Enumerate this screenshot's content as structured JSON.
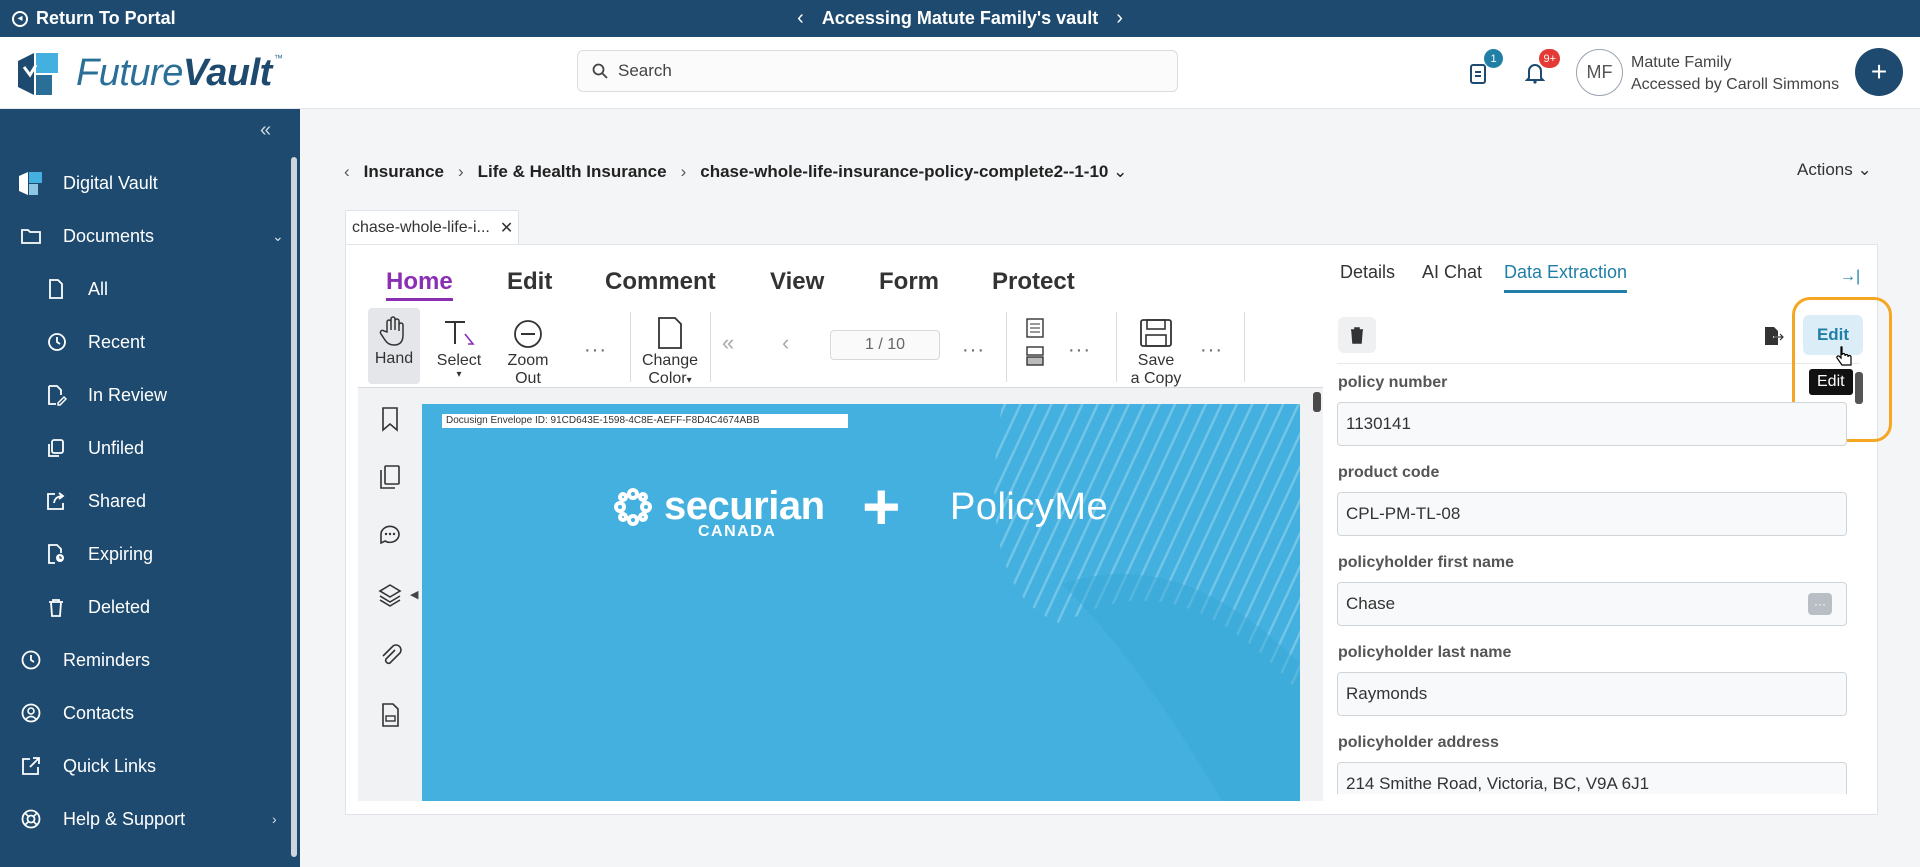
{
  "banner": {
    "return_label": "Return To Portal",
    "vault_label": "Accessing Matute Family's vault",
    "prev_glyph": "‹",
    "next_glyph": "›"
  },
  "header": {
    "logo_future": "Future",
    "logo_vault": "Vault",
    "logo_tm": "™",
    "search_placeholder": "Search",
    "doc_badge": "1",
    "notif_badge": "9+",
    "avatar_initials": "MF",
    "account_name": "Matute Family",
    "account_sub": "Accessed by Caroll Simmons",
    "fab_glyph": "+"
  },
  "sidebar": {
    "collapse_glyph": "«",
    "items": [
      {
        "label": "Digital Vault",
        "icon": "futurevault-icon"
      },
      {
        "label": "Documents",
        "icon": "folder-icon",
        "arrow": "⌄"
      },
      {
        "label": "All",
        "icon": "file-icon"
      },
      {
        "label": "Recent",
        "icon": "history-icon"
      },
      {
        "label": "In Review",
        "icon": "file-edit-icon"
      },
      {
        "label": "Unfiled",
        "icon": "copy-icon"
      },
      {
        "label": "Shared",
        "icon": "share-icon"
      },
      {
        "label": "Expiring",
        "icon": "file-clock-icon"
      },
      {
        "label": "Deleted",
        "icon": "trash-icon"
      },
      {
        "label": "Reminders",
        "icon": "clock-icon"
      },
      {
        "label": "Contacts",
        "icon": "user-circle-icon"
      },
      {
        "label": "Quick Links",
        "icon": "external-link-icon"
      },
      {
        "label": "Help & Support",
        "icon": "lifebuoy-icon",
        "arrow": "›"
      }
    ]
  },
  "breadcrumb": {
    "back_glyph": "‹",
    "items": [
      "Insurance",
      "Life & Health Insurance",
      "chase-whole-life-insurance-policy-complete2--1-10"
    ],
    "sep": "›",
    "dropdown_glyph": "⌄"
  },
  "actions_label": "Actions ⌄",
  "doc_tab": {
    "label": "chase-whole-life-i...",
    "close": "✕"
  },
  "viewer": {
    "tabs": [
      "Home",
      "Edit",
      "Comment",
      "View",
      "Form",
      "Protect"
    ],
    "tools": {
      "hand": "Hand",
      "select": "Select",
      "zoom_out_1": "Zoom",
      "zoom_out_2": "Out",
      "change_color_1": "Change",
      "change_color_2": "Color",
      "save_copy_1": "Save",
      "save_copy_2": "a Copy"
    },
    "more_glyph": "···",
    "page_indicator": "1 / 10",
    "first_glyph": "«",
    "prev_glyph": "‹",
    "dropdown_glyph": "▾",
    "rail_toggle_glyph": "◀",
    "document": {
      "envelope_id": "Docusign Envelope ID: 91CD643E-1598-4C8E-AEFF-F8D4C4674ABB",
      "brand_main": "securian",
      "brand_sub": "CANADA",
      "plus": "+",
      "partner": "PolicyMe"
    }
  },
  "right_panel": {
    "tabs": [
      "Details",
      "AI Chat",
      "Data Extraction"
    ],
    "active_tab": "Data Extraction",
    "collapse_glyph": "→|",
    "edit_label": "Edit",
    "tooltip": "Edit",
    "fields": [
      {
        "label": "policy number",
        "value": "1130141"
      },
      {
        "label": "product code",
        "value": "CPL-PM-TL-08"
      },
      {
        "label": "policyholder first name",
        "value": "Chase",
        "more": "···"
      },
      {
        "label": "policyholder last name",
        "value": "Raymonds"
      },
      {
        "label": "policyholder address",
        "value": "214 Smithe Road, Victoria, BC, V9A 6J1"
      }
    ]
  },
  "colors": {
    "brand_dark": "#1d4a6e",
    "accent_purple": "#8a2fb3",
    "accent_teal": "#1f7fa6",
    "highlight_orange": "#f5a623",
    "badge_doc": "#1f7fa6",
    "badge_notif": "#e53935",
    "document_blue": "#43b0df"
  }
}
